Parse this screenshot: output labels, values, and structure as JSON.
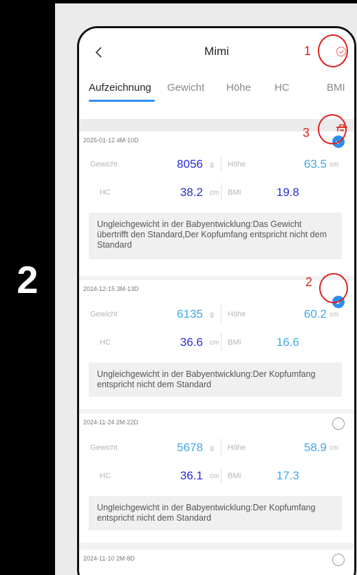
{
  "step": {
    "number": "2"
  },
  "header": {
    "title": "Mimi"
  },
  "tabs": [
    {
      "label": "Aufzeichnung",
      "active": true
    },
    {
      "label": "Gewicht"
    },
    {
      "label": "Höhe"
    },
    {
      "label": "HC"
    },
    {
      "label": "BMI"
    }
  ],
  "annotations": {
    "a1": "1",
    "a2": "2",
    "a3": "3"
  },
  "labels": {
    "weight": "Gewicht",
    "height": "Höhe",
    "hc": "HC",
    "bmi": "BMI",
    "g": "g",
    "cm": "cm"
  },
  "records": [
    {
      "date": "2025-01-12 4M-10D",
      "selected": true,
      "weight": "8056",
      "height": "63.5",
      "hc": "38.2",
      "bmi": "19.8",
      "note": "Ungleichgewicht in der Babyentwicklung:Das Gewicht übertrifft den Standard,Der Kopfumfang entspricht nicht dem Standard"
    },
    {
      "date": "2024-12-15 3M-13D",
      "selected": true,
      "weight": "6135",
      "height": "60.2",
      "hc": "36.6",
      "bmi": "16.6",
      "note": "Ungleichgewicht in der Babyentwicklung:Der Kopfumfang entspricht nicht dem Standard"
    },
    {
      "date": "2024-11-24 2M-22D",
      "selected": false,
      "weight": "5678",
      "height": "58.9",
      "hc": "36.1",
      "bmi": "17.3",
      "note": "Ungleichgewicht in der Babyentwicklung:Der Kopfumfang entspricht nicht dem Standard"
    },
    {
      "date": "2024-11-10 2M-8D",
      "selected": false
    }
  ],
  "colors": {
    "accent": "#2d8cf0",
    "annotation": "#e0201c",
    "value_dark": "#2b2bd6",
    "value_light": "#3fa7e8"
  }
}
